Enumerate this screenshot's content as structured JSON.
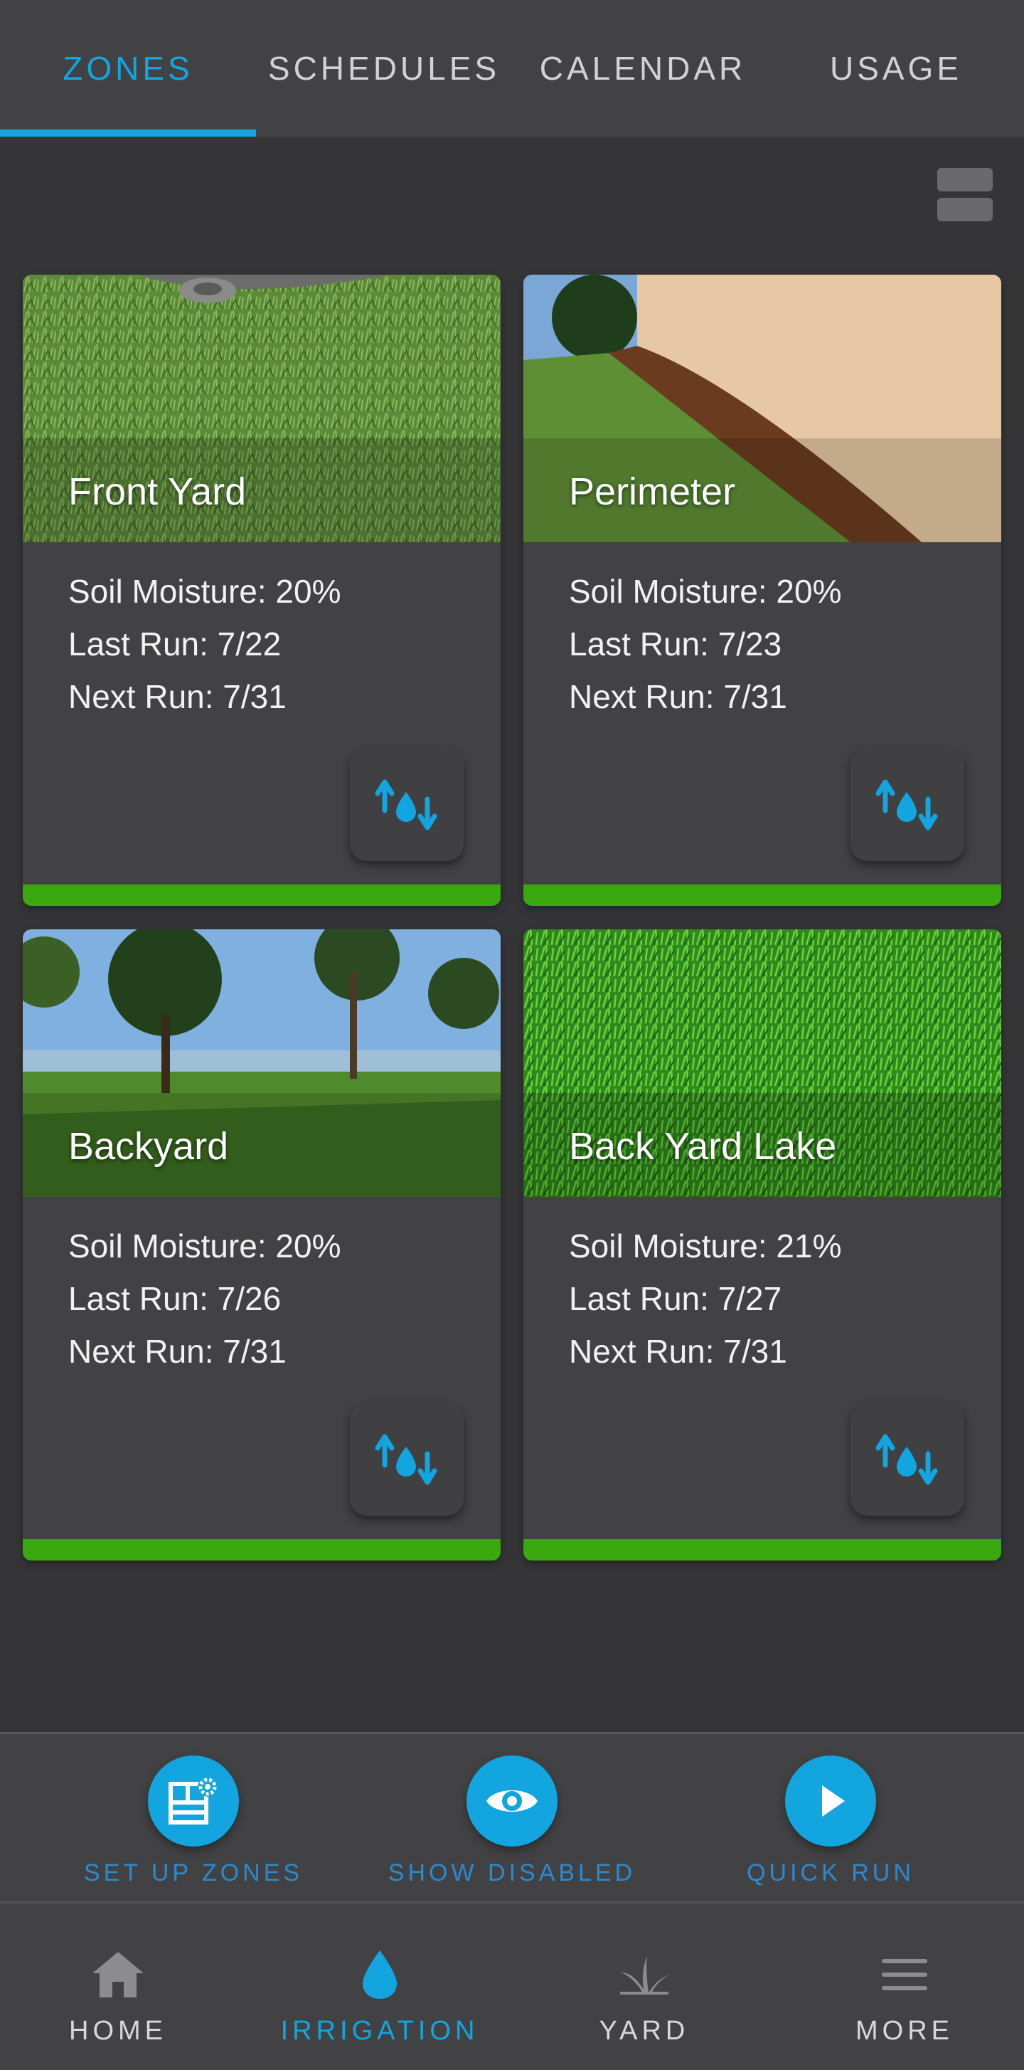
{
  "tabs": [
    {
      "label": "ZONES",
      "active": true
    },
    {
      "label": "SCHEDULES",
      "active": false
    },
    {
      "label": "CALENDAR",
      "active": false
    },
    {
      "label": "USAGE",
      "active": false
    }
  ],
  "view_toggle_icon": "list-view-icon",
  "zones": [
    {
      "name": "Front Yard",
      "soil_moisture": "Soil Moisture: 20%",
      "last_run": "Last Run: 7/22",
      "next_run": "Next Run: 7/31",
      "photo": "grass-with-sprinkler-head",
      "status_color": "#3aa80f"
    },
    {
      "name": "Perimeter",
      "soil_moisture": "Soil Moisture: 20%",
      "last_run": "Last Run: 7/23",
      "next_run": "Next Run: 7/31",
      "photo": "wall-with-mulch-bed",
      "status_color": "#3aa80f"
    },
    {
      "name": "Backyard",
      "soil_moisture": "Soil Moisture: 20%",
      "last_run": "Last Run: 7/26",
      "next_run": "Next Run: 7/31",
      "photo": "lawn-with-lake-and-palms",
      "status_color": "#3aa80f"
    },
    {
      "name": "Back Yard Lake",
      "soil_moisture": "Soil Moisture: 21%",
      "last_run": "Last Run: 7/27",
      "next_run": "Next Run: 7/31",
      "photo": "close-up-grass",
      "status_color": "#3aa80f"
    }
  ],
  "actions": [
    {
      "label": "SET UP ZONES",
      "icon": "zone-setup-icon"
    },
    {
      "label": "SHOW DISABLED",
      "icon": "eye-icon"
    },
    {
      "label": "QUICK RUN",
      "icon": "play-icon"
    }
  ],
  "nav": [
    {
      "label": "HOME",
      "icon": "home-icon",
      "active": false
    },
    {
      "label": "IRRIGATION",
      "icon": "water-drop-icon",
      "active": true
    },
    {
      "label": "YARD",
      "icon": "grass-icon",
      "active": false
    },
    {
      "label": "MORE",
      "icon": "menu-icon",
      "active": false
    }
  ],
  "colors": {
    "accent": "#12a5df",
    "status_ok": "#3aa80f",
    "background": "#353537",
    "surface": "#424244"
  }
}
